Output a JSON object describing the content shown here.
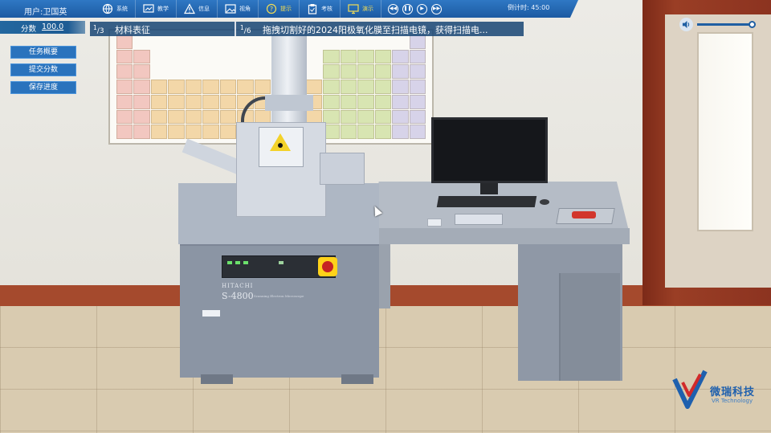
{
  "header": {
    "user_label": "用户:卫国英",
    "toolbar": [
      {
        "label": "系统",
        "icon": "globe-icon"
      },
      {
        "label": "教学",
        "icon": "teaching-icon"
      },
      {
        "label": "信息",
        "icon": "warning-icon"
      },
      {
        "label": "视角",
        "icon": "image-icon"
      },
      {
        "label": "提示",
        "icon": "help-icon"
      },
      {
        "label": "考核",
        "icon": "clipboard-icon"
      },
      {
        "label": "演示",
        "icon": "monitor-icon"
      }
    ],
    "media_controls": [
      "rewind-icon",
      "pause-icon",
      "play-icon",
      "fast-forward-icon"
    ],
    "countdown_label": "倒计时:",
    "countdown_value": "45:00",
    "highlight_color": "#f3dd55",
    "bar_color": "#1c5aa2"
  },
  "score": {
    "label": "分数",
    "value": "100.0"
  },
  "progress": {
    "stage_index": "1",
    "stage_total": "3",
    "stage_name": "材料表征",
    "step_index": "1",
    "step_total": "6",
    "step_instruction": "拖拽切割好的2024阳极氧化膜至扫描电镜，获得扫描电..."
  },
  "side_menu": [
    {
      "label": "任务概要"
    },
    {
      "label": "提交分数"
    },
    {
      "label": "保存进度"
    }
  ],
  "volume": {
    "icon": "speaker-icon",
    "level": 0.95
  },
  "scene": {
    "instrument_brand": "HITACHI",
    "instrument_model": "S-4800",
    "instrument_subtitle": "Scanning Electron Microscope"
  },
  "logo": {
    "name": "微瑞科技",
    "subtitle": "VR Technology"
  }
}
